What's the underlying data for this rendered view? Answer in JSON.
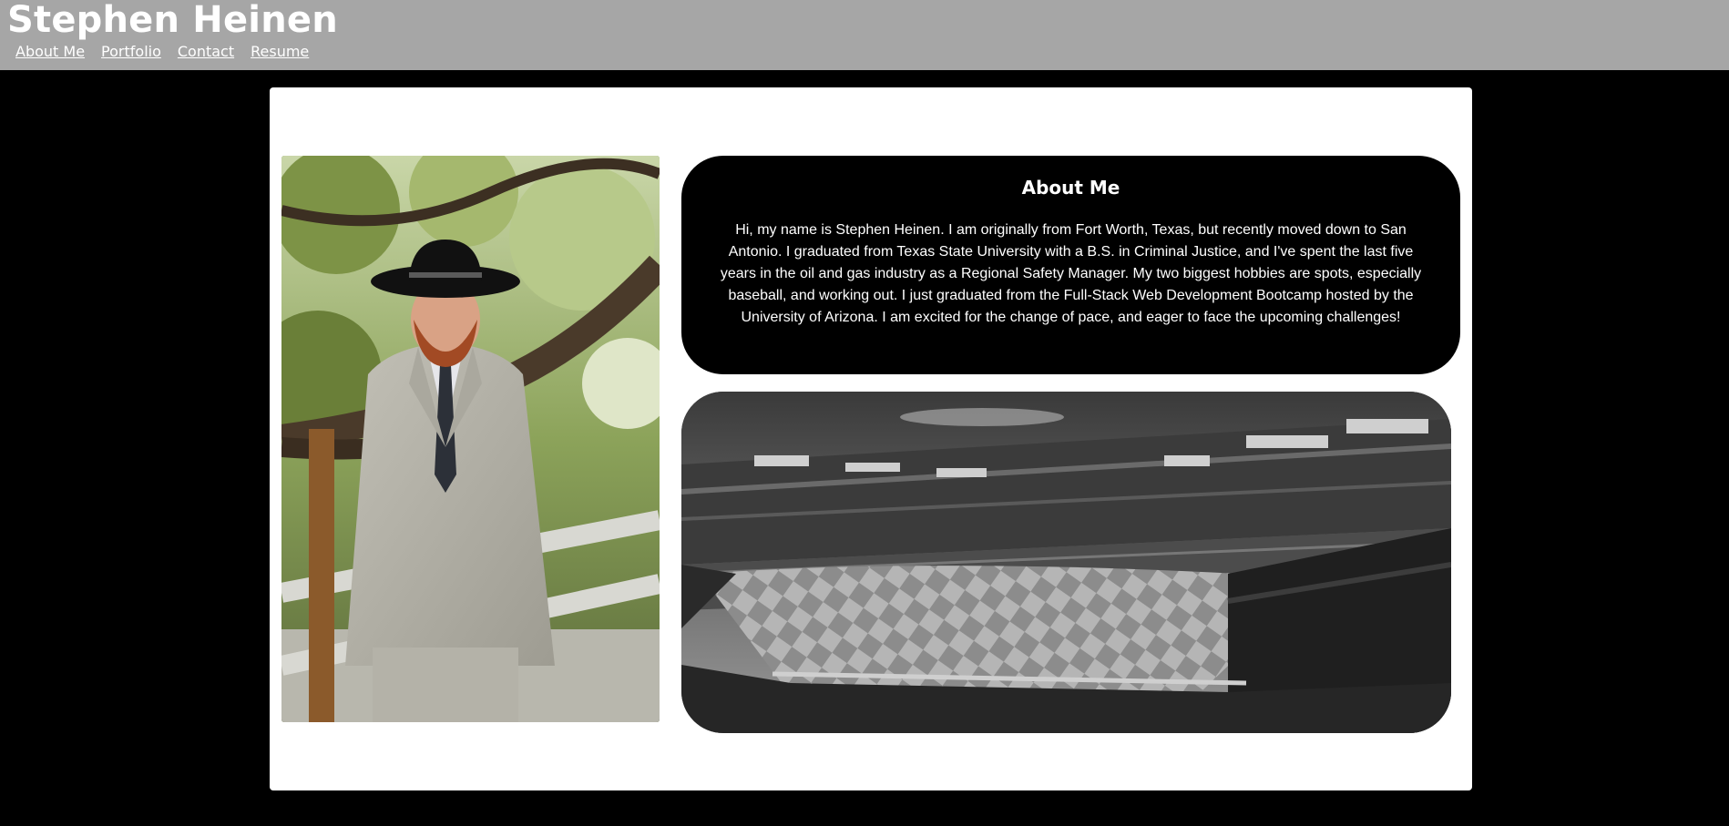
{
  "header": {
    "title": "Stephen Heinen",
    "nav": [
      {
        "label": "About Me"
      },
      {
        "label": "Portfolio"
      },
      {
        "label": "Contact"
      },
      {
        "label": "Resume"
      }
    ]
  },
  "about": {
    "heading": "About Me",
    "text": "Hi, my name is Stephen Heinen. I am originally from Fort Worth, Texas, but recently moved down to San Antonio. I graduated from Texas State University with a B.S. in Criminal Justice, and I've spent the last five years in the oil and gas industry as a Regional Safety Manager. My two biggest hobbies are spots, especially baseball, and working out. I just graduated from the Full-Stack Web Development Bootcamp hosted by the University of Arizona. I am excited for the change of pace, and eager to face the upcoming challenges!"
  },
  "images": {
    "portrait": "portrait-photo",
    "stadium": "baseball-stadium-photo"
  },
  "colors": {
    "header_bg": "#a6a6a6",
    "page_bg": "#000000",
    "card_bg": "#ffffff",
    "about_bg": "#000000",
    "text_light": "#ffffff"
  }
}
